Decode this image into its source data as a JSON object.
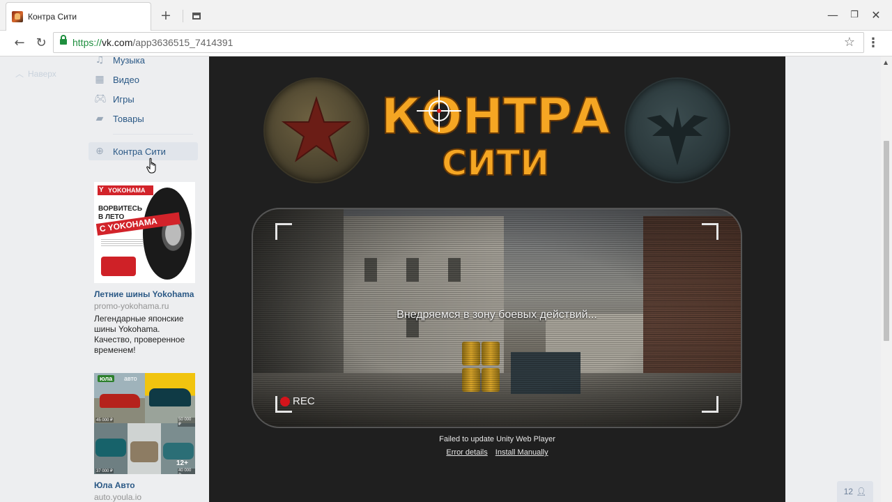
{
  "browser": {
    "tab_title": "Контра Сити",
    "new_tab_icon": "plus-icon",
    "url_scheme": "https://",
    "url_host": "vk.com",
    "url_path": "/app3636515_7414391",
    "window_controls": [
      "minimize",
      "maximize",
      "close"
    ]
  },
  "sidebar": {
    "back_to_top": "Наверх",
    "items": [
      {
        "label": "Музыка",
        "icon": "music-note-icon"
      },
      {
        "label": "Видео",
        "icon": "film-icon"
      },
      {
        "label": "Игры",
        "icon": "gamepad-icon"
      },
      {
        "label": "Товары",
        "icon": "shopping-bag-icon"
      },
      {
        "label": "Контра Сити",
        "icon": "crosshair-icon",
        "active": true
      }
    ]
  },
  "ads": [
    {
      "title": "Летние шины Yokohama",
      "domain": "promo-yokohama.ru",
      "text": "Легендарные японские шины Yokohama. Качество, проверенное временем!",
      "art": {
        "brand": "YOKOHAMA",
        "headline": "ВОРВИТЕСЬ В ЛЕТО",
        "band": "С YOKOHAMA"
      }
    },
    {
      "title": "Юла Авто",
      "domain": "auto.youla.io",
      "art": {
        "tag": "юла",
        "tag2": "авто",
        "age": "12+",
        "prices": [
          "45 000 ₽",
          "50 000 ₽",
          "37 000 ₽",
          "40 000 ₽"
        ]
      }
    }
  ],
  "game": {
    "logo_line1": "КОНТРА",
    "logo_line2": "СИТИ",
    "loading_text": "Внедряемся в зону боевых действий...",
    "rec_label": "REC",
    "unity_message": "Failed to update Unity Web Player",
    "error_details_link": "Error details",
    "install_link": "Install Manually"
  },
  "friends": {
    "count": "12",
    "icon": "person-icon"
  },
  "colors": {
    "vk_link": "#2a5885",
    "game_bg": "#1f1f1f",
    "logo_gold": "#f5a623",
    "rec_red": "#d4141b"
  }
}
